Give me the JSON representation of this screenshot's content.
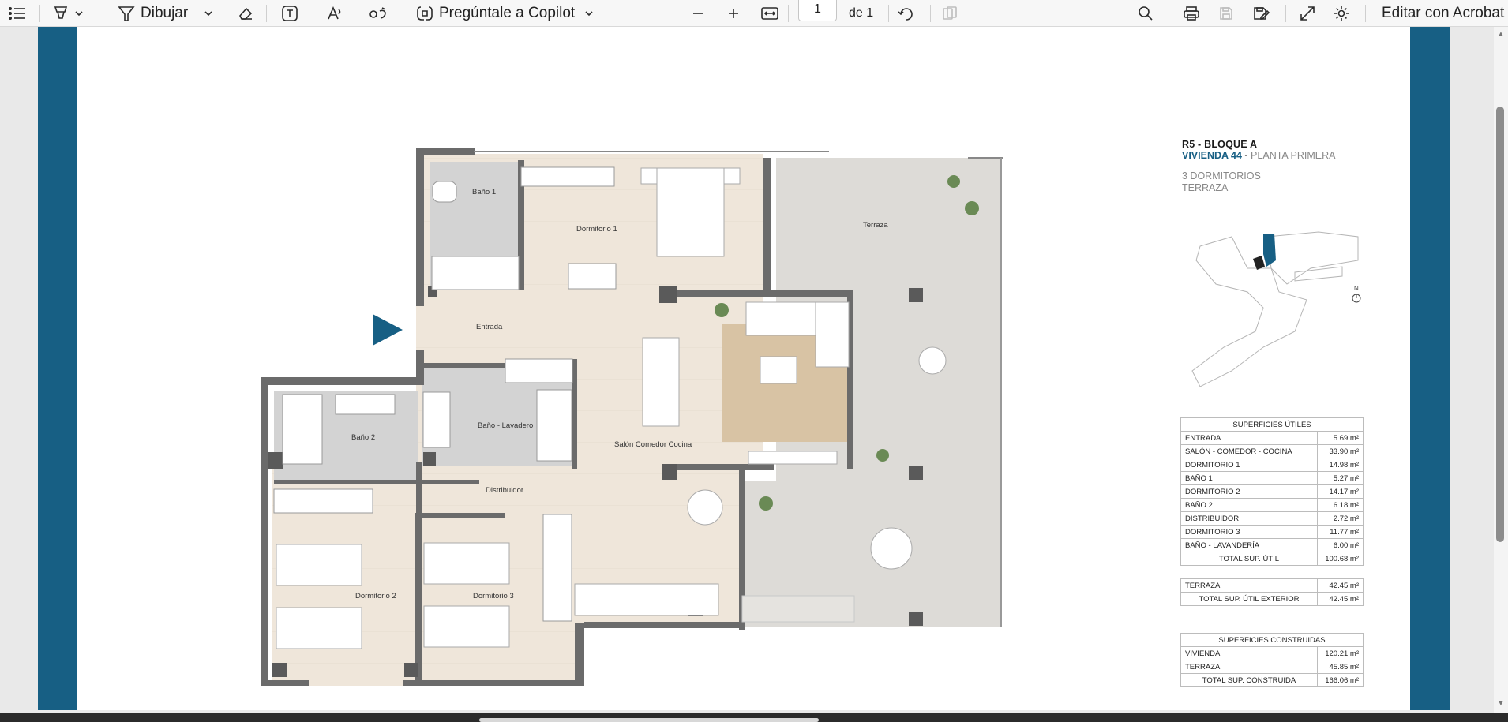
{
  "toolbar": {
    "draw_label": "Dibujar",
    "copilot_label": "Pregúntale a Copilot",
    "page_number": "1",
    "page_total": "de 1",
    "edit_acrobat_label": "Editar con Acrobat"
  },
  "plan_info": {
    "title": "R5 - BLOQUE A",
    "unit": "VIVIENDA 44",
    "floor": " - PLANTA PRIMERA",
    "bedrooms": "3 DORMITORIOS",
    "terrace": "TERRAZA",
    "north": "N"
  },
  "rooms": {
    "bano1": "Baño 1",
    "dormitorio1": "Dormitorio 1",
    "terraza": "Terraza",
    "entrada": "Entrada",
    "bano2": "Baño 2",
    "bano_lavadero": "Baño - Lavadero",
    "salon": "Salón Comedor Cocina",
    "distribuidor": "Distribuidor",
    "dormitorio2": "Dormitorio 2",
    "dormitorio3": "Dormitorio 3"
  },
  "superficies_utiles": {
    "header": "SUPERFICIES ÚTILES",
    "rows": [
      {
        "label": "ENTRADA",
        "value": "5.69 m²"
      },
      {
        "label": "SALÓN  - COMEDOR - COCINA",
        "value": "33.90 m²"
      },
      {
        "label": "DORMITORIO 1",
        "value": "14.98 m²"
      },
      {
        "label": "BAÑO 1",
        "value": "5.27 m²"
      },
      {
        "label": "DORMITORIO 2",
        "value": "14.17 m²"
      },
      {
        "label": "BAÑO 2",
        "value": "6.18 m²"
      },
      {
        "label": "DISTRIBUIDOR",
        "value": "2.72 m²"
      },
      {
        "label": "DORMITORIO 3",
        "value": "11.77 m²"
      },
      {
        "label": "BAÑO - LAVANDERÍA",
        "value": "6.00 m²"
      }
    ],
    "total_label": "TOTAL SUP. ÚTIL",
    "total_value": "100.68 m²"
  },
  "exterior": {
    "rows": [
      {
        "label": "TERRAZA",
        "value": "42.45 m²"
      }
    ],
    "total_label": "TOTAL SUP. ÚTIL EXTERIOR",
    "total_value": "42.45 m²"
  },
  "superficies_construidas": {
    "header": "SUPERFICIES CONSTRUIDAS",
    "rows": [
      {
        "label": "VIVIENDA",
        "value": "120.21 m²"
      },
      {
        "label": "TERRAZA",
        "value": "45.85 m²"
      }
    ],
    "total_label": "TOTAL SUP. CONSTRUIDA",
    "total_value": "166.06 m²"
  },
  "colors": {
    "brand_blue": "#175f84",
    "wood_floor": "#ede3d6",
    "tile_floor": "#d7d7d7",
    "terrace_floor": "#dedcd8",
    "rug": "#d9c4a6"
  }
}
